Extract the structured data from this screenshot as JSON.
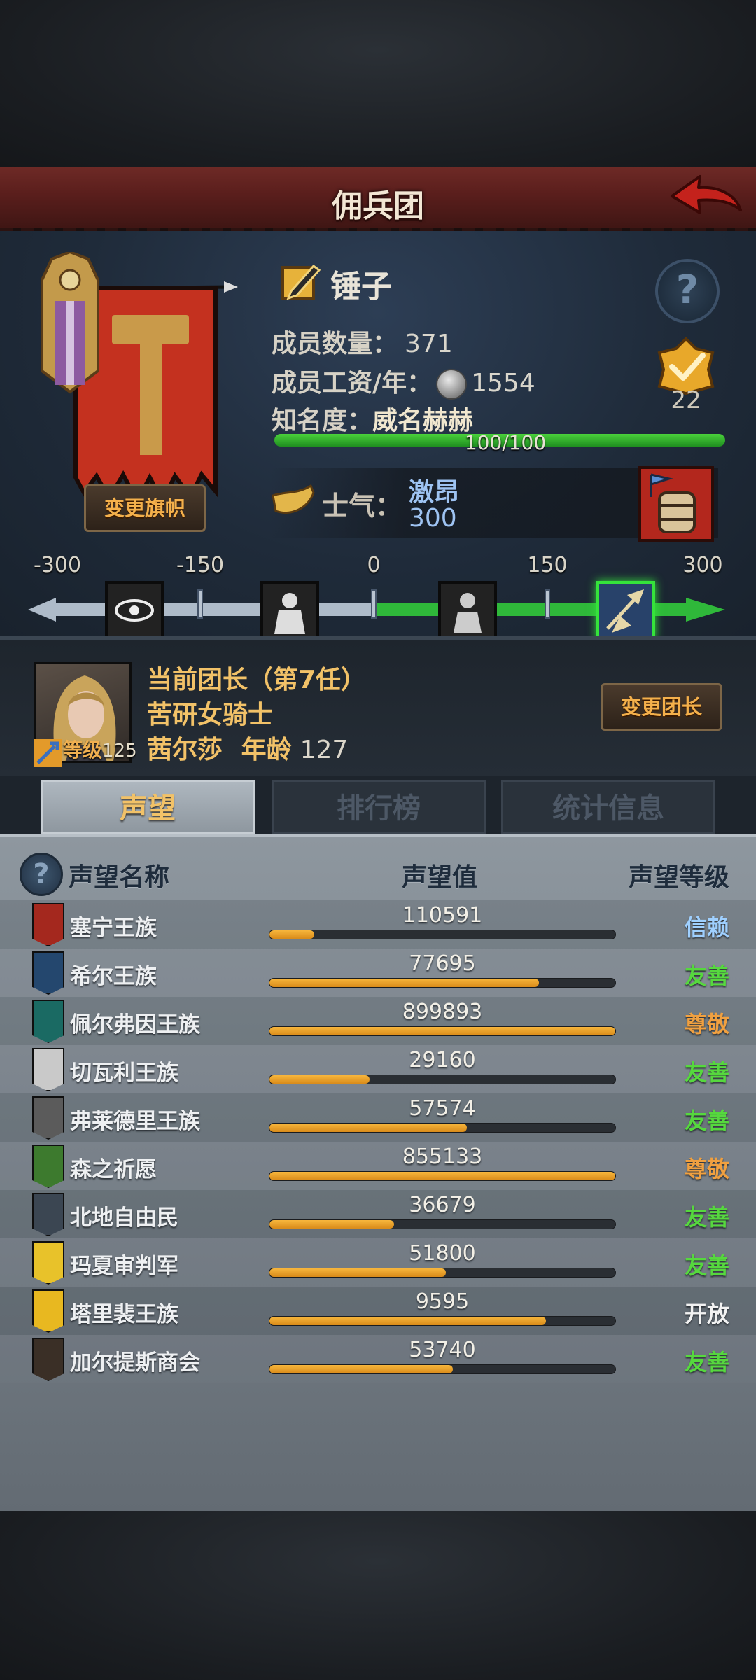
{
  "header": {
    "title": "佣兵团"
  },
  "guild": {
    "name": "锤子",
    "change_banner_label": "变更旗帜",
    "members_label": "成员数量：",
    "members": "371",
    "wage_label": "成员工资/年：",
    "wage": "1554",
    "fame_label": "知名度：",
    "fame_value": "威名赫赫",
    "fame_progress_text": "100/100",
    "fame_progress": 1.0,
    "badge_count": "22",
    "morale_label": "士气：",
    "morale_state": "激昂",
    "morale_value": "300"
  },
  "morale_scale": {
    "labels": [
      "-300",
      "-150",
      "0",
      "150",
      "300"
    ],
    "current": 300
  },
  "leader": {
    "title": "当前团长（第7任）",
    "class": "苦研女骑士",
    "name": "茜尔莎",
    "age_label": "年龄",
    "age": "127",
    "level_label": "等级",
    "level": "125",
    "change_leader_label": "变更团长"
  },
  "tabs": [
    {
      "label": "声望",
      "active": true
    },
    {
      "label": "排行榜",
      "active": false
    },
    {
      "label": "统计信息",
      "active": false
    }
  ],
  "reputation": {
    "col_name": "声望名称",
    "col_value": "声望值",
    "col_level": "声望等级",
    "rows": [
      {
        "name": "塞宁王族",
        "value": "110591",
        "progress": 0.13,
        "level": "信赖",
        "level_color": "#9fd0ff",
        "icon_color": "#a4281e"
      },
      {
        "name": "希尔王族",
        "value": "77695",
        "progress": 0.78,
        "level": "友善",
        "level_color": "#56d83e",
        "icon_color": "#24476e"
      },
      {
        "name": "佩尔弗因王族",
        "value": "899893",
        "progress": 1.0,
        "level": "尊敬",
        "level_color": "#f0a040",
        "icon_color": "#1a6a63"
      },
      {
        "name": "切瓦利王族",
        "value": "29160",
        "progress": 0.29,
        "level": "友善",
        "level_color": "#56d83e",
        "icon_color": "#c9c9c9"
      },
      {
        "name": "弗莱德里王族",
        "value": "57574",
        "progress": 0.57,
        "level": "友善",
        "level_color": "#56d83e",
        "icon_color": "#5b5b5b"
      },
      {
        "name": "森之祈愿",
        "value": "855133",
        "progress": 1.0,
        "level": "尊敬",
        "level_color": "#f0a040",
        "icon_color": "#3d7a2e"
      },
      {
        "name": "北地自由民",
        "value": "36679",
        "progress": 0.36,
        "level": "友善",
        "level_color": "#56d83e",
        "icon_color": "#3b4652"
      },
      {
        "name": "玛夏审判军",
        "value": "51800",
        "progress": 0.51,
        "level": "友善",
        "level_color": "#56d83e",
        "icon_color": "#e8c22a"
      },
      {
        "name": "塔里裴王族",
        "value": "9595",
        "progress": 0.8,
        "level": "开放",
        "level_color": "#f2f2f2",
        "icon_color": "#e8b820"
      },
      {
        "name": "加尔提斯商会",
        "value": "53740",
        "progress": 0.53,
        "level": "友善",
        "level_color": "#56d83e",
        "icon_color": "#3a2f26"
      }
    ]
  }
}
